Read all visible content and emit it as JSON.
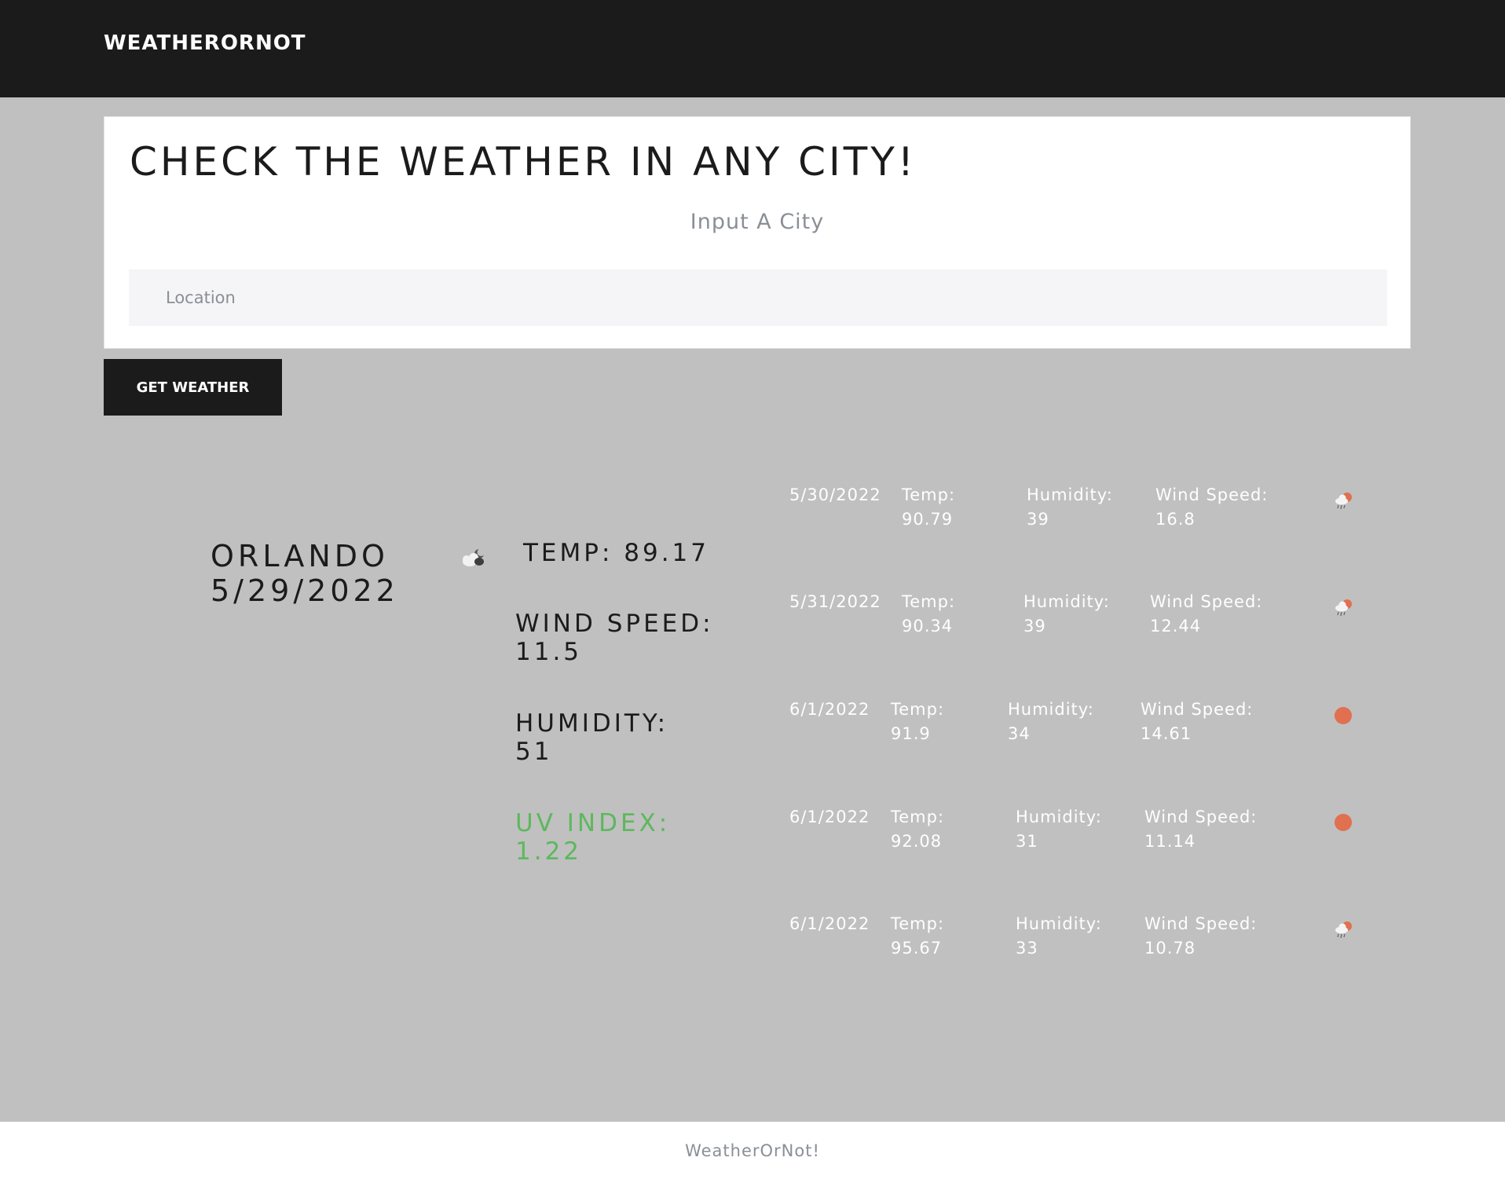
{
  "nav": {
    "brand": "WEATHERORNOT"
  },
  "search": {
    "headline": "CHECK THE WEATHER IN ANY CITY!",
    "subhead": "Input A City",
    "placeholder": "Location",
    "button_label": "GET WEATHER"
  },
  "current": {
    "city": "ORLANDO",
    "date": "5/29/2022",
    "icon": "cloudy-night-icon",
    "temp_line": "TEMP: 89.17",
    "wind_label": "WIND SPEED:",
    "wind_value": "11.5",
    "humidity_label": "HUMIDITY:",
    "humidity_value": "51",
    "uv_label": "UV INDEX:",
    "uv_value": "1.22",
    "uv_color": "#5cb85c"
  },
  "forecast": [
    {
      "date": "5/30/2022",
      "temp_label": "Temp:",
      "temp": "90.79",
      "humidity_label": "Humidity:",
      "humidity": "39",
      "wind_label": "Wind Speed:",
      "wind": "16.8",
      "icon": "rain-sun-icon"
    },
    {
      "date": "5/31/2022",
      "temp_label": "Temp:",
      "temp": "90.34",
      "humidity_label": "Humidity:",
      "humidity": "39",
      "wind_label": "Wind Speed:",
      "wind": "12.44",
      "icon": "rain-sun-icon"
    },
    {
      "date": "6/1/2022",
      "temp_label": "Temp:",
      "temp": "91.9",
      "humidity_label": "Humidity:",
      "humidity": "34",
      "wind_label": "Wind Speed:",
      "wind": "14.61",
      "icon": "sun-icon"
    },
    {
      "date": "6/1/2022",
      "temp_label": "Temp:",
      "temp": "92.08",
      "humidity_label": "Humidity:",
      "humidity": "31",
      "wind_label": "Wind Speed:",
      "wind": "11.14",
      "icon": "sun-icon"
    },
    {
      "date": "6/1/2022",
      "temp_label": "Temp:",
      "temp": "95.67",
      "humidity_label": "Humidity:",
      "humidity": "33",
      "wind_label": "Wind Speed:",
      "wind": "10.78",
      "icon": "rain-sun-icon"
    }
  ],
  "footer": {
    "text": "WeatherOrNot!"
  },
  "colors": {
    "nav_bg": "#1b1b1b",
    "page_bg": "#c0c0c0",
    "sun": "#e07050",
    "uv": "#5cb85c"
  }
}
